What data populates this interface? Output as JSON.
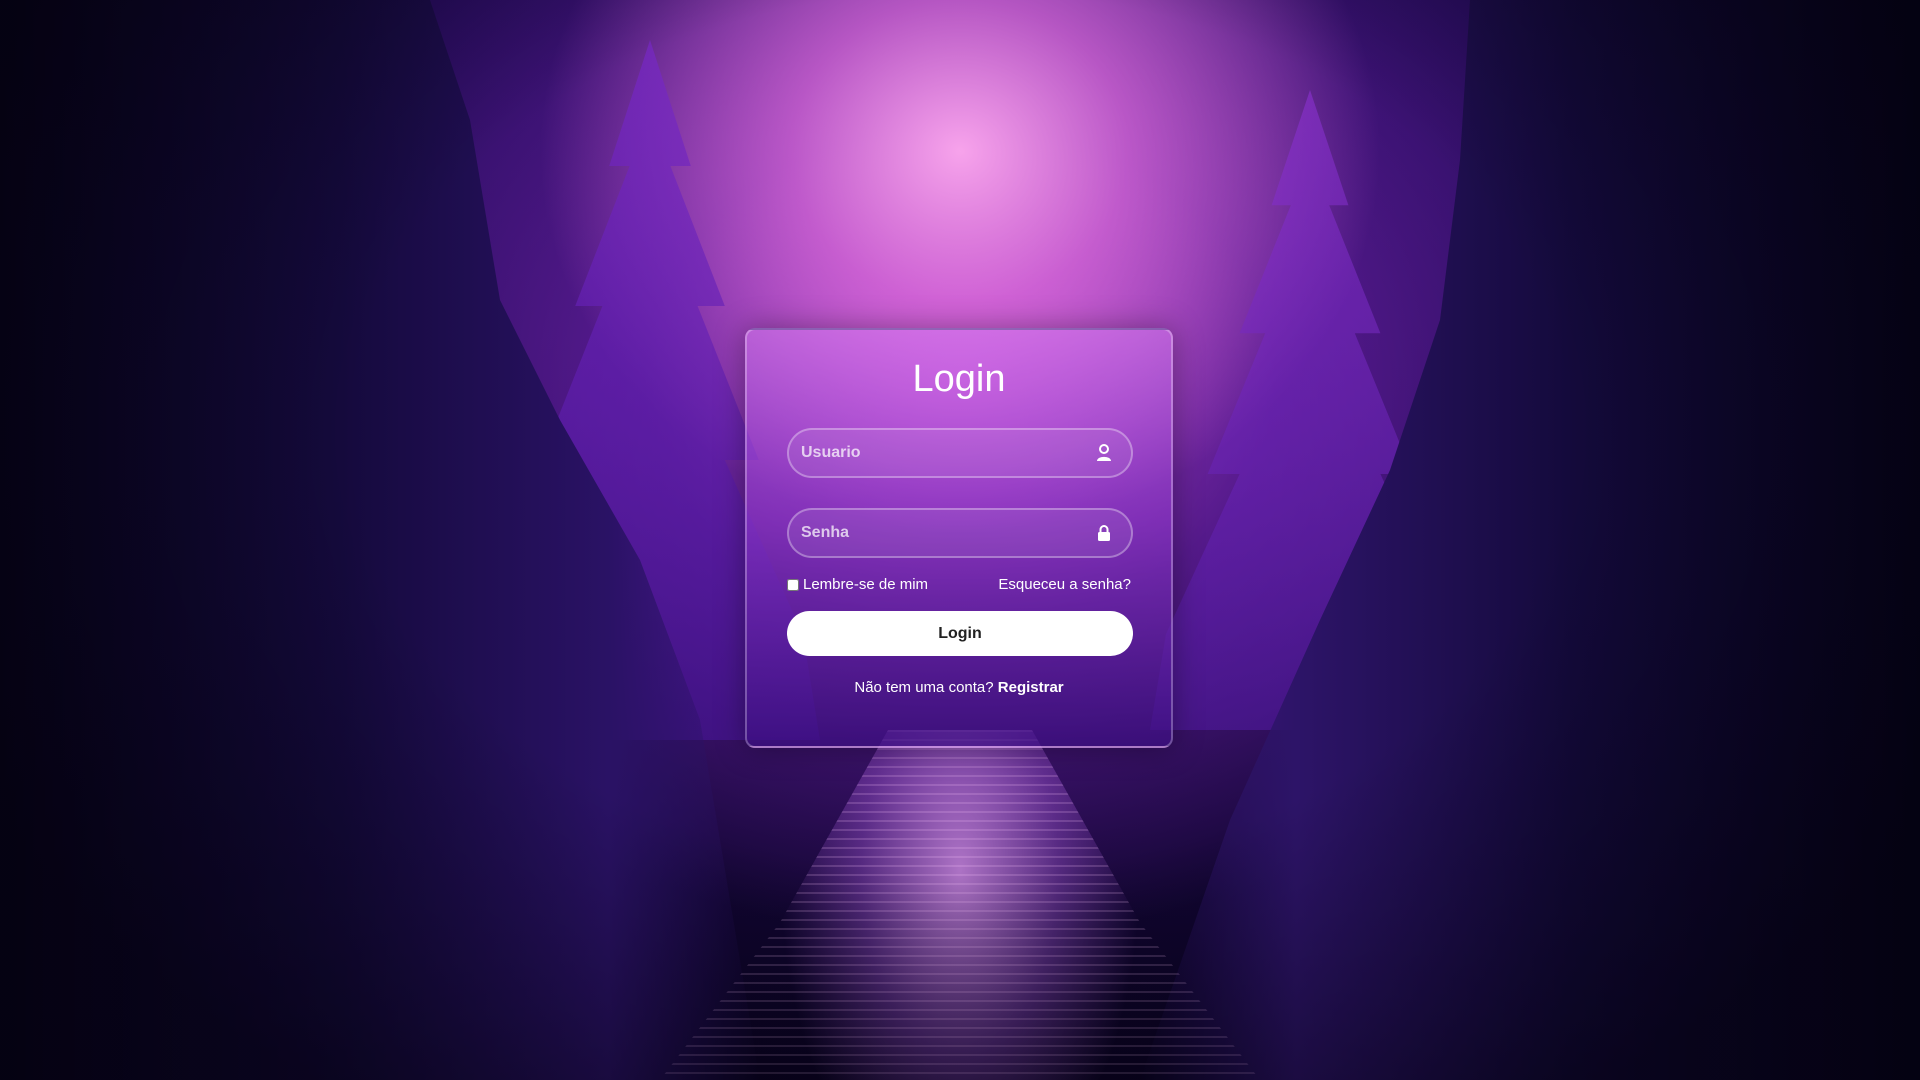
{
  "colors": {
    "card_border": "#ffffff",
    "button_bg": "#ffffff",
    "button_text": "#222222",
    "text": "#ffffff",
    "sky_pink": "#f29bf0",
    "night_purple": "#2a0d62"
  },
  "login_form": {
    "title": "Login",
    "username": {
      "placeholder": "Usuario",
      "value": "",
      "icon": "user-icon"
    },
    "password": {
      "placeholder": "Senha",
      "value": "",
      "icon": "lock-icon"
    },
    "remember_me": {
      "label": "Lembre-se de mim",
      "checked": false
    },
    "forgot_password_label": "Esqueceu a senha?",
    "submit_label": "Login",
    "register_prompt": "Não tem uma conta?",
    "register_link_label": "Registrar"
  }
}
